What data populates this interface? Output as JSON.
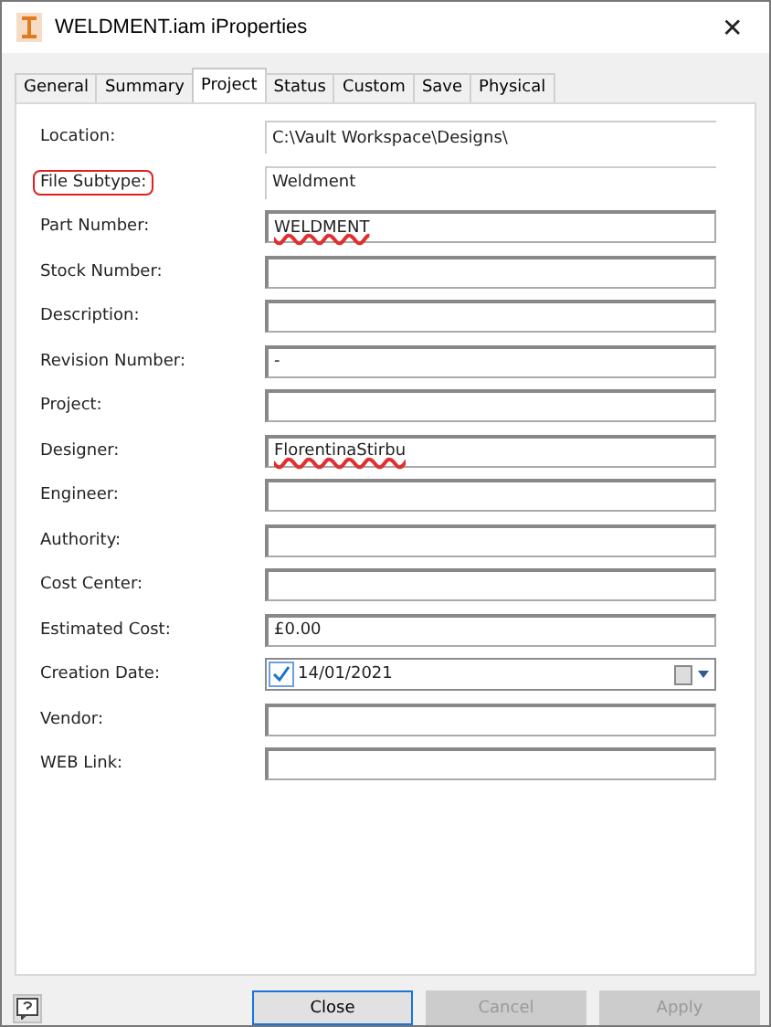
{
  "window": {
    "title": "WELDMENT.iam iProperties",
    "close": "✕"
  },
  "tabs": [
    {
      "label": "General",
      "selected": false
    },
    {
      "label": "Summary",
      "selected": false
    },
    {
      "label": "Project",
      "selected": true
    },
    {
      "label": "Status",
      "selected": false
    },
    {
      "label": "Custom",
      "selected": false
    },
    {
      "label": "Save",
      "selected": false
    },
    {
      "label": "Physical",
      "selected": false
    }
  ],
  "fields": [
    {
      "label": "Location:",
      "kind": "readonly",
      "value": "C:\\Vault Workspace\\Designs\\",
      "highlighted": false,
      "misspelled": false
    },
    {
      "label": "File Subtype:",
      "kind": "readonly",
      "value": "Weldment",
      "highlighted": true,
      "misspelled": false
    },
    {
      "label": "Part Number:",
      "kind": "text",
      "value": "WELDMENT",
      "highlighted": false,
      "misspelled": true
    },
    {
      "label": "Stock Number:",
      "kind": "text",
      "highlighted": false
    },
    {
      "label": "Description:",
      "kind": "text",
      "highlighted": false
    },
    {
      "label": "Revision Number:",
      "kind": "text",
      "value": "-",
      "highlighted": false
    },
    {
      "label": "Project:",
      "kind": "text",
      "highlighted": false
    },
    {
      "label": "Designer:",
      "kind": "text",
      "value": "FlorentinaStirbu",
      "highlighted": false,
      "misspelled": true
    },
    {
      "label": "Engineer:",
      "kind": "text",
      "highlighted": false
    },
    {
      "label": "Authority:",
      "kind": "text",
      "highlighted": false
    },
    {
      "label": "Cost Center:",
      "kind": "text",
      "highlighted": false
    },
    {
      "label": "Estimated Cost:",
      "kind": "text",
      "value": "£0.00",
      "highlighted": false,
      "misspelled": false
    },
    {
      "label": "Creation Date:",
      "kind": "date",
      "value": "14/01/2021",
      "checked": true,
      "highlighted": false,
      "misspelled": false
    },
    {
      "label": "Vendor:",
      "kind": "text",
      "highlighted": false
    },
    {
      "label": "WEB Link:",
      "kind": "text",
      "highlighted": false
    }
  ],
  "buttons": [
    {
      "label": "Close",
      "disabled": false
    },
    {
      "label": "Cancel",
      "disabled": true
    },
    {
      "label": "Apply",
      "disabled": true
    }
  ]
}
